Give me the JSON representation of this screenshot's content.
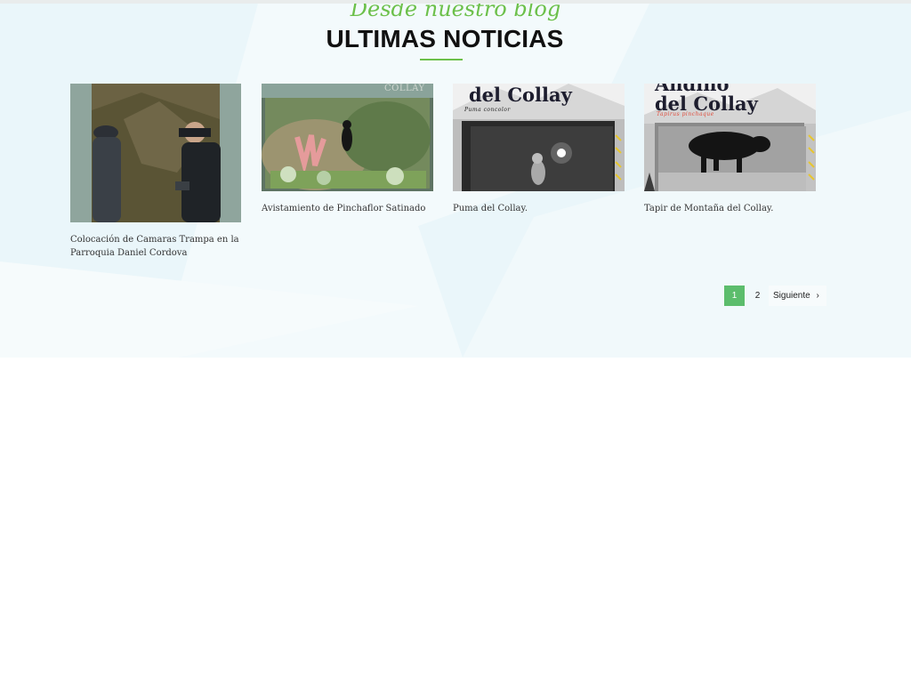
{
  "section": {
    "kicker": "Desde nuestro blog",
    "title": "ULTIMAS NOTICIAS"
  },
  "posts": [
    {
      "title": "Colocación de Camaras Trampa en la Parroquia Daniel Cordova",
      "image_alt": "Personas instalando cámara trampa en el bosque"
    },
    {
      "title": "Avistamiento de Pinchaflor Satinado",
      "image_alt": "Pinchaflor satinado posado sobre flores",
      "overlay": "COLLAY"
    },
    {
      "title": "Puma del Collay.",
      "image_alt": "Puma captado por cámara trampa",
      "overlay_title": "del Collay",
      "overlay_sub": "Puma concolor"
    },
    {
      "title": "Tapir de Montaña del Collay.",
      "image_alt": "Tapir de montaña captado por cámara trampa",
      "overlay_title_1": "Andino",
      "overlay_title_2": "del Collay",
      "overlay_sub": "Tapirus pinchaque"
    }
  ],
  "pagination": {
    "current": "1",
    "page2": "2",
    "next_label": "Siguiente",
    "next_icon": "chevron-right-icon"
  },
  "colors": {
    "accent": "#6cc04a",
    "active_page": "#5cbd6c",
    "hero_bg": "#eaf6fa"
  }
}
